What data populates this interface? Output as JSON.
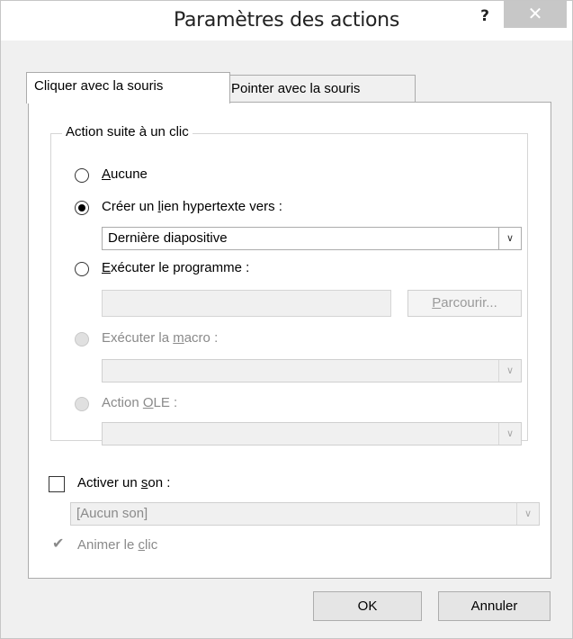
{
  "window": {
    "title": "Paramètres des actions",
    "help_label": "?",
    "close_label": "✕"
  },
  "tabs": [
    {
      "label": "Cliquer avec la souris",
      "active": true
    },
    {
      "label": "Pointer avec la souris",
      "active": false
    }
  ],
  "action_group": {
    "legend": "Action suite à un clic",
    "none_label": {
      "underline": "A",
      "rest": "ucune"
    },
    "hyperlink_label": {
      "before": "Créer un ",
      "underline": "l",
      "after": "ien hypertexte vers :"
    },
    "hyperlink_value": "Dernière diapositive",
    "program_label": {
      "underline": "E",
      "rest": "xécuter le programme :"
    },
    "program_value": "",
    "browse_label": {
      "underline": "P",
      "rest": "arcourir..."
    },
    "macro_label": {
      "before": "Exécuter la ",
      "underline": "m",
      "after": "acro :"
    },
    "macro_value": "",
    "ole_label": {
      "before": "Action ",
      "underline": "O",
      "after": "LE :"
    },
    "ole_value": "",
    "selected": "hyperlink"
  },
  "sound": {
    "label": {
      "before": "Activer un ",
      "underline": "s",
      "after": "on :"
    },
    "checked": false,
    "value": "[Aucun son]"
  },
  "animate": {
    "label": {
      "before": "Animer le ",
      "underline": "c",
      "after": "lic"
    },
    "checked": true
  },
  "footer": {
    "ok_label": "OK",
    "cancel_label": "Annuler"
  },
  "icons": {
    "dropdown": "chevron-down-icon",
    "checkmark": "checkmark-icon"
  }
}
